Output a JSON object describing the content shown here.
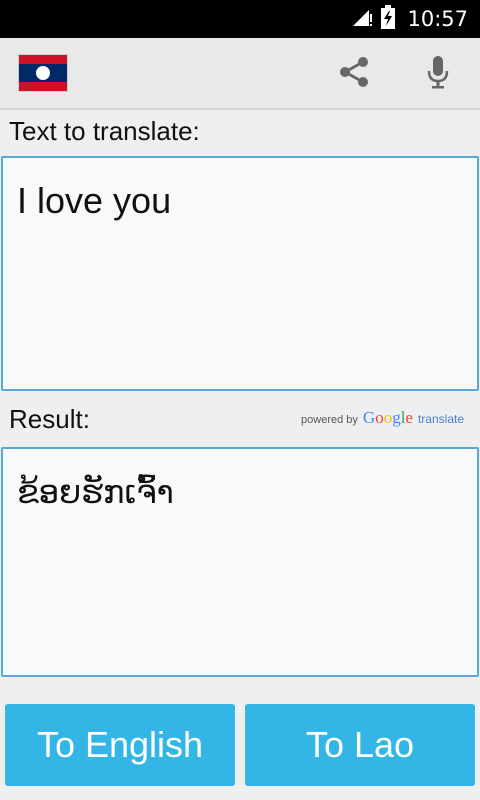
{
  "status_bar": {
    "time": "10:57",
    "icons": [
      "signal-icon",
      "battery-charging-icon"
    ]
  },
  "action_bar": {
    "flag": "laos-flag-icon",
    "actions": [
      "share-icon",
      "microphone-icon"
    ]
  },
  "input": {
    "label": "Text to translate:",
    "text": "I love you"
  },
  "result": {
    "label": "Result:",
    "text": "ຂ້ອຍຮັກເຈົ້າ",
    "powered_by": "powered by",
    "google": "Google",
    "translate": "translate"
  },
  "buttons": {
    "to_english": "To English",
    "to_lao": "To Lao"
  },
  "colors": {
    "accent": "#33b5e5",
    "box_border": "#5aa7d8",
    "flag_red": "#ce1126",
    "flag_blue": "#002868"
  }
}
